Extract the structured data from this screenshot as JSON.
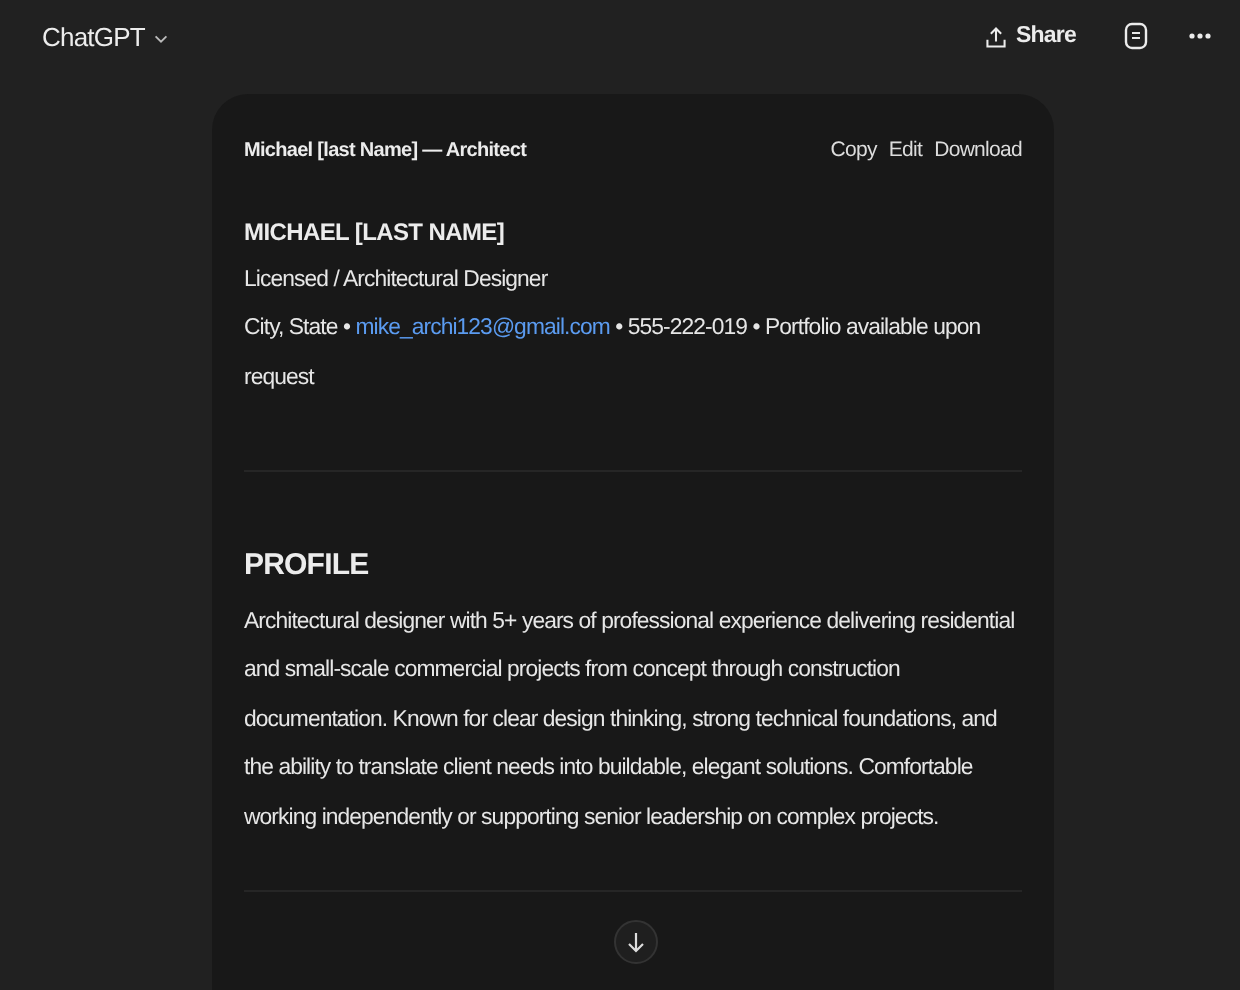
{
  "header": {
    "title": "ChatGPT",
    "actions": [
      {
        "kind": "share",
        "label": "Share"
      },
      {
        "kind": "doc"
      },
      {
        "kind": "more"
      }
    ]
  },
  "canvas": {
    "title": "Michael [last Name] — Architect",
    "actions": [
      "Copy",
      "Edit",
      "Download"
    ],
    "name": "MICHAEL [LAST NAME]",
    "role": "Licensed / Architectural Designer",
    "contact": {
      "before": "City, State •",
      "email": "mike_archi123@gmail.com",
      "after": "• 555-222-019 • Portfolio available upon request"
    },
    "sections": [
      {
        "heading": "PROFILE",
        "text": "Architectural designer with 5+ years of professional experience delivering residential and small-scale commercial projects from concept through construction documentation. Known for clear design thinking, strong technical foundations, and the ability to translate client needs into buildable, elegant solutions. Comfortable working independently or supporting senior leadership on complex projects."
      }
    ]
  }
}
